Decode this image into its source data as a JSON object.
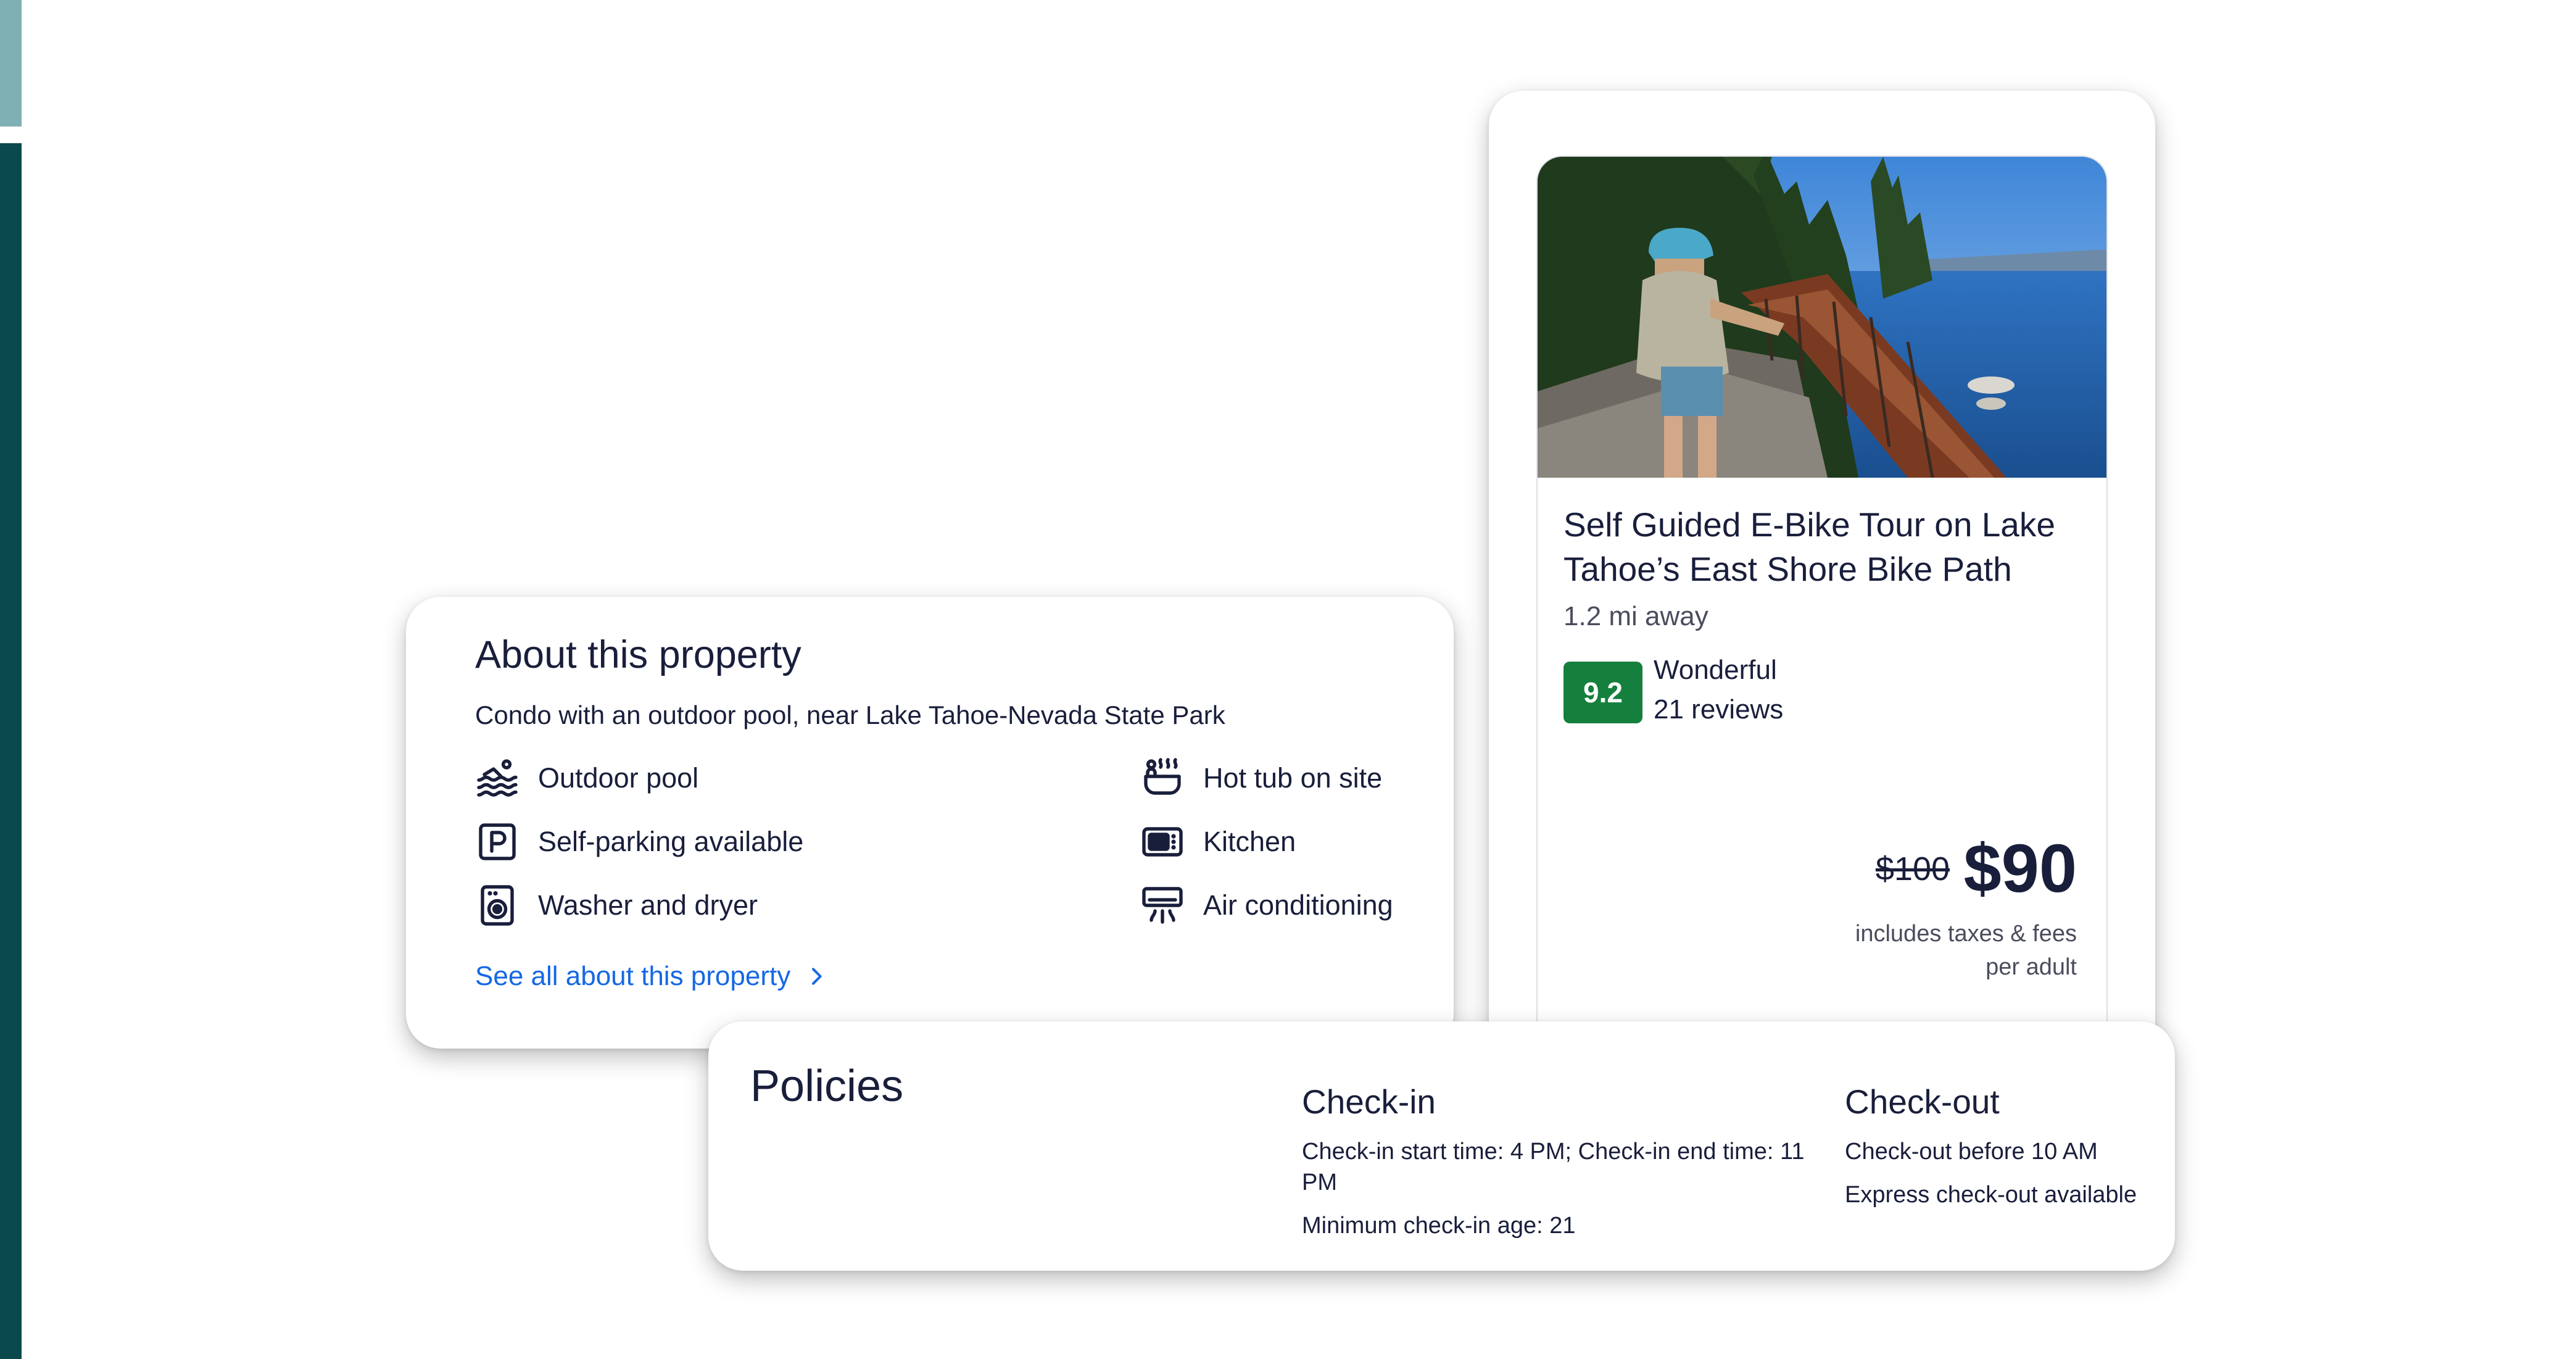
{
  "activity": {
    "title": "Self Guided E-Bike Tour on Lake Tahoe’s East Shore Bike Path",
    "distance": "1.2 mi away",
    "score": "9.2",
    "rating_label": "Wonderful",
    "reviews": "21 reviews",
    "old_price": "$100",
    "price": "$90",
    "price_note_1": "includes taxes & fees",
    "price_note_2": "per adult"
  },
  "about": {
    "title": "About this property",
    "subtitle": "Condo with an outdoor pool, near Lake Tahoe-Nevada State Park",
    "amenities": [
      {
        "label": "Outdoor pool",
        "icon": "pool-icon"
      },
      {
        "label": "Hot tub on site",
        "icon": "hot-tub-icon"
      },
      {
        "label": "Self-parking available",
        "icon": "parking-icon"
      },
      {
        "label": "Kitchen",
        "icon": "kitchen-icon"
      },
      {
        "label": "Washer and dryer",
        "icon": "washer-icon"
      },
      {
        "label": "Air conditioning",
        "icon": "air-conditioning-icon"
      }
    ],
    "see_all": "See all about this property"
  },
  "policies": {
    "title": "Policies",
    "checkin": {
      "heading": "Check-in",
      "line1": "Check-in start time: 4 PM; Check-in end time: 11 PM",
      "line2": "Minimum check-in age: 21"
    },
    "checkout": {
      "heading": "Check-out",
      "line1": "Check-out before 10 AM",
      "line2": "Express check-out available"
    }
  },
  "colors": {
    "score_badge": "#15803d",
    "link": "#1668e3",
    "text": "#191e3b",
    "side_bar_dark": "#0b4a4c",
    "side_bar_light": "#7fb0b3"
  }
}
